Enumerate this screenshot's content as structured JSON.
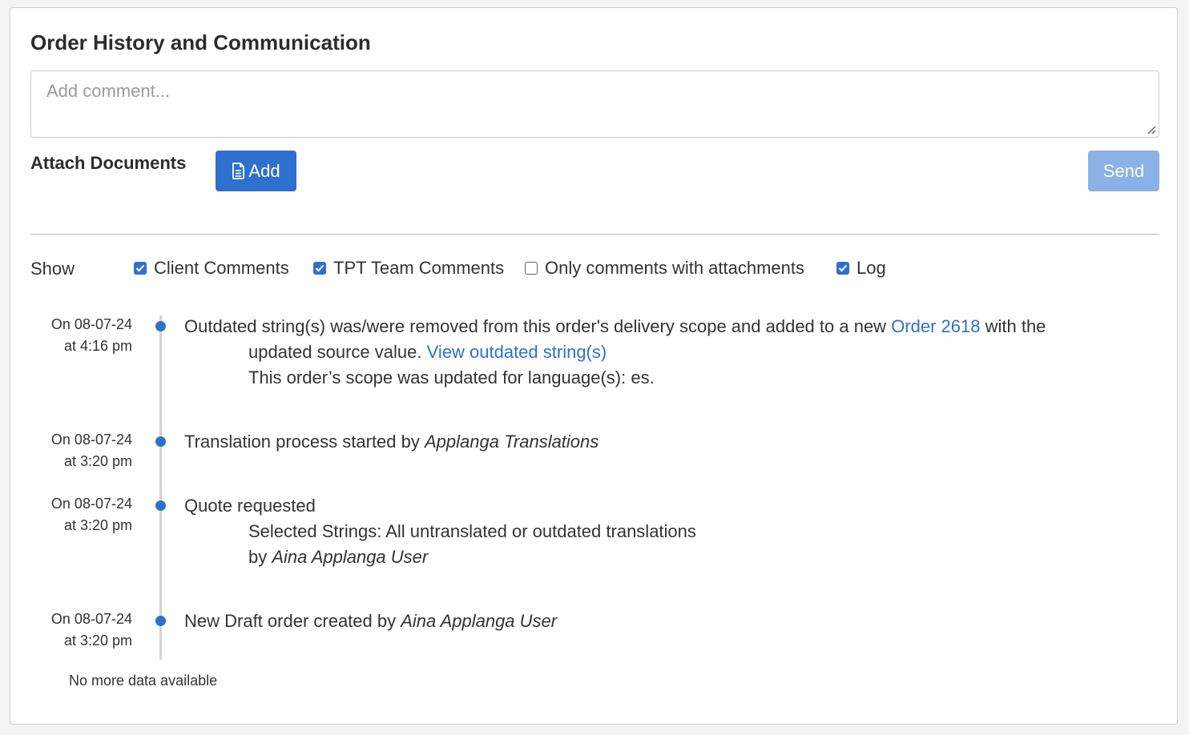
{
  "panel": {
    "title": "Order History and Communication",
    "comment_placeholder": "Add comment...",
    "attach_label": "Attach Documents",
    "add_button": "Add",
    "send_button": "Send"
  },
  "filters": {
    "show_label": "Show",
    "items": [
      {
        "label": "Client Comments",
        "checked": true
      },
      {
        "label": "TPT Team Comments",
        "checked": true
      },
      {
        "label": "Only comments with attachments",
        "checked": false
      },
      {
        "label": "Log",
        "checked": true
      }
    ]
  },
  "timeline": [
    {
      "date_line1": "On 08-07-24",
      "date_line2": "at 4:16 pm",
      "line1_pre": "Outdated string(s) was/were removed from this order's delivery scope and added to a new ",
      "line1_link": "Order 2618",
      "line1_post": " with the",
      "line2_pre": "updated source value. ",
      "line2_link": "View outdated string(s)",
      "line3": "This order’s scope was updated for language(s): es."
    },
    {
      "date_line1": "On 08-07-24",
      "date_line2": "at 3:20 pm",
      "text_pre": "Translation process started by ",
      "text_em": "Applanga Translations"
    },
    {
      "date_line1": "On 08-07-24",
      "date_line2": "at 3:20 pm",
      "line1": "Quote requested",
      "line2": "Selected Strings: All untranslated or outdated translations",
      "line3_pre": "by ",
      "line3_em": "Aina Applanga User"
    },
    {
      "date_line1": "On 08-07-24",
      "date_line2": "at 3:20 pm",
      "text_pre": "New Draft order created by ",
      "text_em": "Aina Applanga User"
    }
  ],
  "footer": {
    "no_more": "No more data available"
  },
  "colors": {
    "accent": "#2f6fce",
    "send_disabled": "#8ab2e6",
    "link": "#2f6fce"
  },
  "icons": {
    "add_button_icon": "file-icon",
    "checkbox_checked": "check-icon"
  }
}
